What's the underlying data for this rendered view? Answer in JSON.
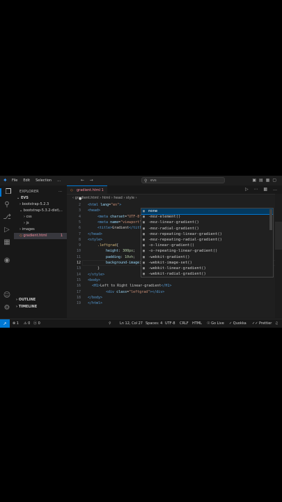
{
  "menu": [
    "File",
    "Edit",
    "Selection",
    "…"
  ],
  "nav": {
    "back": "←",
    "forward": "→"
  },
  "search": {
    "value": "evs"
  },
  "explorer": {
    "header": "EXPLORER",
    "more": "…",
    "root": "EVS",
    "items": [
      {
        "label": "bootstrap-5.2.3",
        "indent": 8,
        "chevron": "›"
      },
      {
        "label": "bootstrap-5.3.2-dist\\...",
        "indent": 8,
        "chevron": "⌄"
      },
      {
        "label": "css",
        "indent": 14,
        "chevron": "›"
      },
      {
        "label": "js",
        "indent": 14,
        "chevron": "›"
      },
      {
        "label": "images",
        "indent": 8,
        "chevron": "›"
      },
      {
        "label": "gradient.html",
        "indent": 8,
        "chevron": "",
        "badge": "1",
        "selected": true
      }
    ],
    "outline": "OUTLINE",
    "timeline": "TIMELINE"
  },
  "tab": {
    "label": "gradient.html",
    "count": "1",
    "dot": "●"
  },
  "breadcrumbs": "‹ gradient.html › html › head › style ›",
  "code_lines": [
    {
      "n": "2",
      "html": "<span class='tag'>&lt;html</span> <span class='attr'>lang</span>=<span class='str'>\"en\"</span><span class='tag'>&gt;</span>",
      "indent": 0
    },
    {
      "n": "3",
      "html": "<span class='tag'>&lt;head&gt;</span>",
      "indent": 0
    },
    {
      "n": "4",
      "html": "<span class='tag'>&lt;meta</span> <span class='attr'>charset</span>=<span class='str'>\"UTF-8\"</span>",
      "indent": 14
    },
    {
      "n": "5",
      "html": "<span class='tag'>&lt;meta</span> <span class='attr'>name</span>=<span class='str'>\"viewport\"</span>",
      "indent": 14
    },
    {
      "n": "6",
      "html": "<span class='tag'>&lt;title&gt;</span><span class='txt'>Gradient</span><span class='tag'>&lt;/title&gt;</span>",
      "indent": 14
    },
    {
      "n": "7",
      "html": "<span class='tag'>&lt;/head&gt;</span>",
      "indent": 0
    },
    {
      "n": "8",
      "html": "<span class='tag'>&lt;style&gt;</span>",
      "indent": 0
    },
    {
      "n": "9",
      "html": "<span class='sel-css'>.leftgrad</span>{",
      "indent": 14
    },
    {
      "n": "10",
      "html": "<span class='prop'>height</span>: <span class='num'>300px</span>;",
      "indent": 26
    },
    {
      "n": "11",
      "html": "<span class='prop'>padding</span>: <span class='num'>10vh</span>;",
      "indent": 26
    },
    {
      "n": "12",
      "html": "<span class='prop'>background-image</span>: ;",
      "indent": 26,
      "current": true
    },
    {
      "n": "13",
      "html": "}",
      "indent": 14
    },
    {
      "n": "14",
      "html": "<span class='tag'>&lt;/style&gt;</span>",
      "indent": 0
    },
    {
      "n": "15",
      "html": "<span class='tag'>&lt;body&gt;</span>",
      "indent": 0
    },
    {
      "n": "16",
      "html": "<span class='tag'>&lt;H1&gt;</span><span class='txt'>Left to Right linear-gradient</span><span class='tag'>&lt;/H1&gt;</span>",
      "indent": 6
    },
    {
      "n": "17",
      "html": "<span class='tag'>&lt;div</span> <span class='attr'>class</span>=<span class='str'>\"leftgrad\"</span><span class='tag'>&gt;&lt;/div&gt;</span>",
      "indent": 26
    },
    {
      "n": "18",
      "html": "<span class='tag'>&lt;/body&gt;</span>",
      "indent": 0
    },
    {
      "n": "19",
      "html": "<span class='tag'>&lt;/html&gt;</span>",
      "indent": 0
    }
  ],
  "suggestions": [
    "none",
    "-moz-element()",
    "-moz-linear-gradient()",
    "-moz-radial-gradient()",
    "-moz-repeating-linear-gradient()",
    "-moz-repeating-radial-gradient()",
    "-o-linear-gradient()",
    "-o-repeating-linear-gradient()",
    "-webkit-gradient()",
    "-webkit-image-set()",
    "-webkit-linear-gradient()",
    "-webkit-radial-gradient()"
  ],
  "status": {
    "remote": "↗",
    "errors": "⊗ 1",
    "warnings": "⚠ 0",
    "ports": "ⓧ 0",
    "position": "Ln 12, Col 27",
    "spaces": "Spaces: 4",
    "encoding": "UTF-8",
    "eol": "CRLF",
    "language": "HTML",
    "golive": "Go Live",
    "quokka": "Quokka",
    "prettier": "Prettier"
  },
  "colors": {
    "accent": "#0078d4",
    "error_file": "#f38b9a",
    "suggest_highlight": "#2aaaff"
  }
}
